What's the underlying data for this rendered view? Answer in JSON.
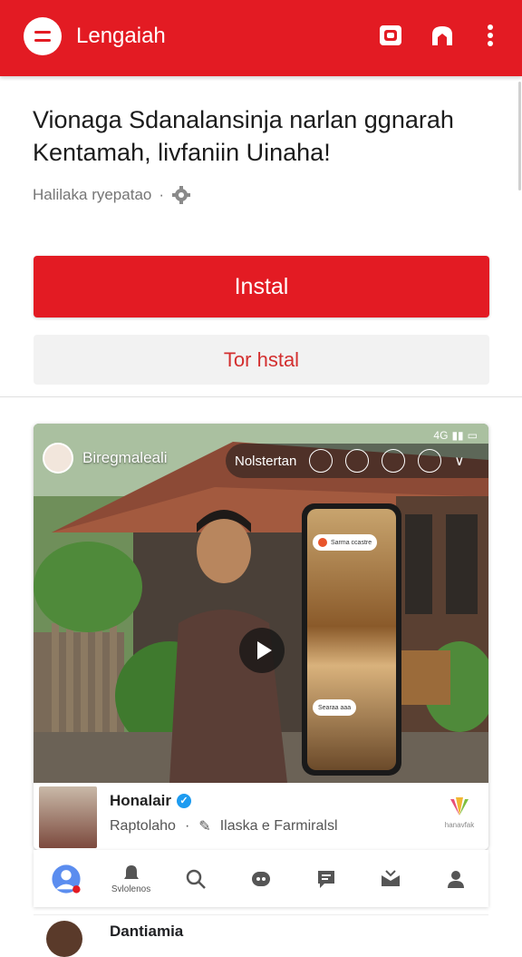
{
  "header": {
    "title": "Lengaiah",
    "accent_color": "#e31b23",
    "icons": [
      "menu-icon",
      "camera-icon",
      "profile-shape-icon",
      "more-vertical-icon"
    ]
  },
  "article": {
    "headline": "Vionaga Sdanalansinja narlan ggnarah Kentamah, livfaniin Uinaha!",
    "meta_text": "Halilaka ryepatao",
    "meta_separator": "·"
  },
  "actions": {
    "primary_label": "Instal",
    "secondary_label": "Tor hstal"
  },
  "video_card": {
    "channel_name": "Biregmaleali",
    "overlay_label": "Nolstertan",
    "status_text": "4G",
    "phone_pill_top": "Sarma ccastre",
    "phone_pill_bottom": "Searaa aaa"
  },
  "post": {
    "author": "Honalair",
    "subtitle": "Raptolaho",
    "subtitle_separator": "·",
    "tag": "Ilaska e Farmiralsl",
    "brand_caption": "hanavfak"
  },
  "bottom_nav": {
    "items": [
      {
        "icon": "avatar-icon",
        "label": ""
      },
      {
        "icon": "notification-icon",
        "label": "Svlolenos"
      },
      {
        "icon": "search-icon",
        "label": ""
      },
      {
        "icon": "games-icon",
        "label": ""
      },
      {
        "icon": "message-icon",
        "label": ""
      },
      {
        "icon": "inbox-icon",
        "label": ""
      },
      {
        "icon": "person-icon",
        "label": ""
      }
    ]
  },
  "next_post": {
    "author": "Dantiamia"
  }
}
